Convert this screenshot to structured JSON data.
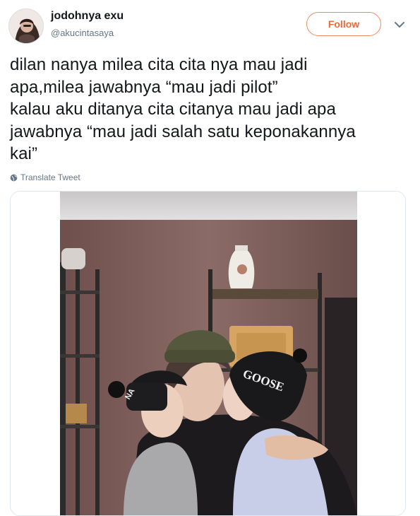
{
  "user": {
    "display_name": "jodohnya exu",
    "handle": "@akucintasaya",
    "avatar_icon": "profile-photo"
  },
  "follow_button": {
    "label": "Follow",
    "color": "#e8693a"
  },
  "menu_icon": "chevron-down-icon",
  "tweet": {
    "text": "dilan nanya milea cita cita nya mau jadi\napa,milea jawabnya “mau jadi pilot”\nkalau aku ditanya cita citanya mau jadi apa\njawabnya “mau jadi salah satu keponakannya\nkai”"
  },
  "translate": {
    "label": "Translate Tweet",
    "icon": "globe-icon"
  },
  "media": {
    "type": "photo",
    "hat_text": "GOOSE",
    "hat_text_left": "NA"
  }
}
